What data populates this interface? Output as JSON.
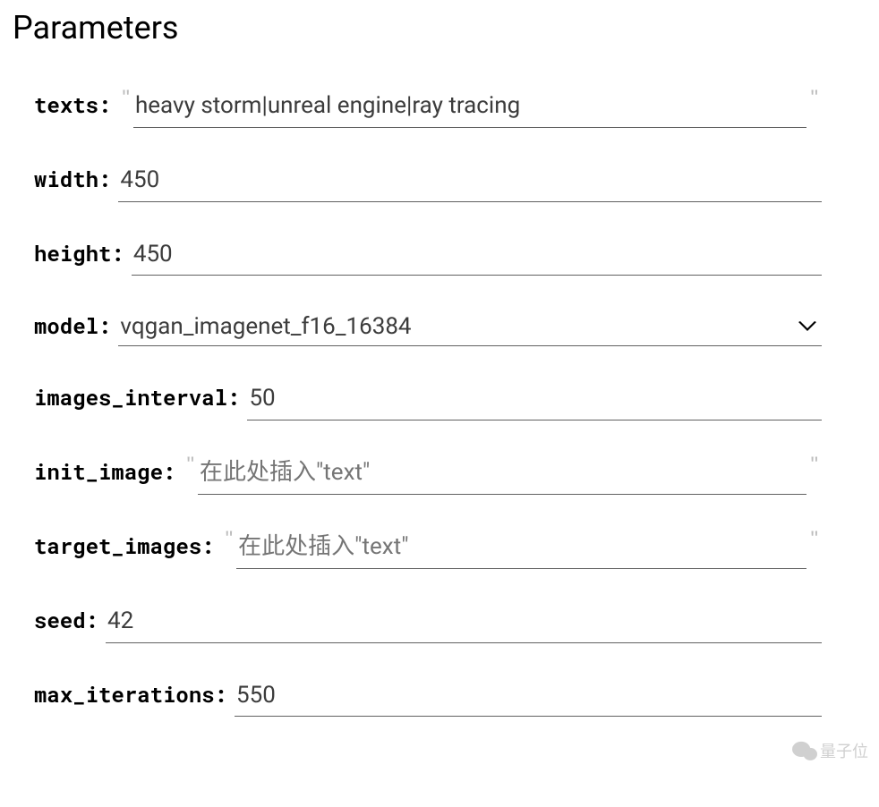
{
  "section_title": "Parameters",
  "fields": {
    "texts": {
      "label": "texts:",
      "value": "heavy storm|unreal engine|ray tracing"
    },
    "width": {
      "label": "width:",
      "value": "450"
    },
    "height": {
      "label": "height:",
      "value": "450"
    },
    "model": {
      "label": "model:",
      "value": "vqgan_imagenet_f16_16384"
    },
    "images_interval": {
      "label": "images_interval:",
      "value": "50"
    },
    "init_image": {
      "label": "init_image:",
      "value": "",
      "placeholder": "在此处插入\"text\""
    },
    "target_images": {
      "label": "target_images:",
      "value": "",
      "placeholder": "在此处插入\"text\""
    },
    "seed": {
      "label": "seed:",
      "value": "42"
    },
    "max_iterations": {
      "label": "max_iterations:",
      "value": "550"
    }
  },
  "watermark": "量子位"
}
